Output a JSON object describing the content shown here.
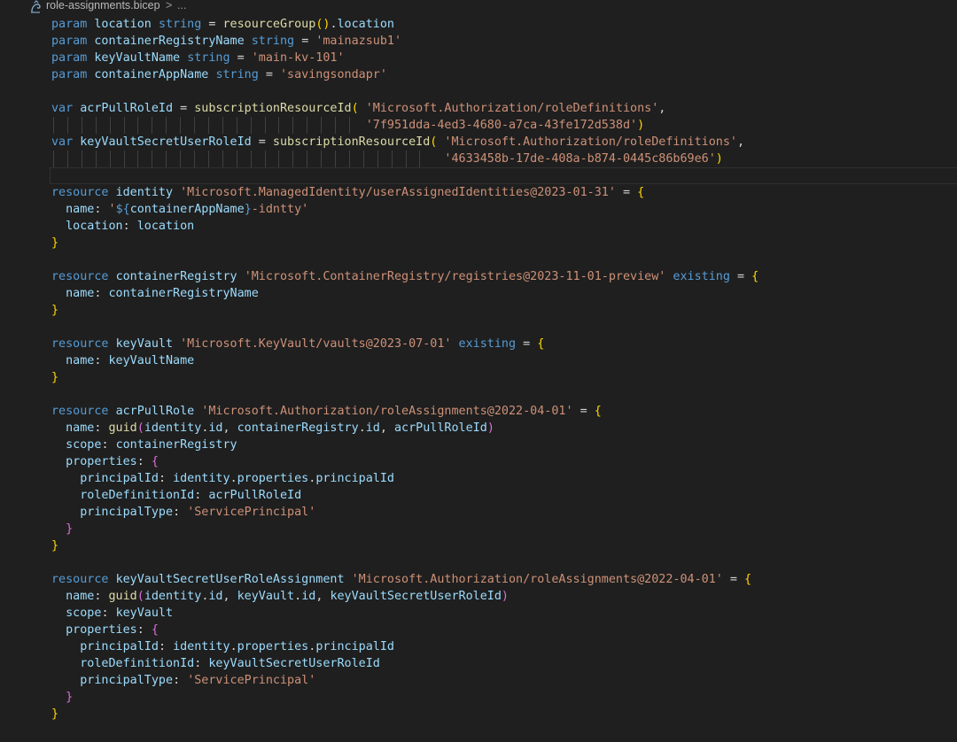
{
  "breadcrumb": {
    "file": "role-assignments.bicep",
    "separator": ">",
    "more": "..."
  },
  "code_lines": [
    "param location string = resourceGroup().location",
    "param containerRegistryName string = 'mainazsub1'",
    "param keyVaultName string = 'main-kv-101'",
    "param containerAppName string = 'savingsondapr'",
    "",
    "var acrPullRoleId = subscriptionResourceId( 'Microsoft.Authorization/roleDefinitions',",
    "                                            '7f951dda-4ed3-4680-a7ca-43fe172d538d')",
    "var keyVaultSecretUserRoleId = subscriptionResourceId( 'Microsoft.Authorization/roleDefinitions',",
    "                                                       '4633458b-17de-408a-b874-0445c86b69e6')",
    "",
    "resource identity 'Microsoft.ManagedIdentity/userAssignedIdentities@2023-01-31' = {",
    "  name: '${containerAppName}-idntty'",
    "  location: location",
    "}",
    "",
    "resource containerRegistry 'Microsoft.ContainerRegistry/registries@2023-11-01-preview' existing = {",
    "  name: containerRegistryName",
    "}",
    "",
    "resource keyVault 'Microsoft.KeyVault/vaults@2023-07-01' existing = {",
    "  name: keyVaultName",
    "}",
    "",
    "resource acrPullRole 'Microsoft.Authorization/roleAssignments@2022-04-01' = {",
    "  name: guid(identity.id, containerRegistry.id, acrPullRoleId)",
    "  scope: containerRegistry",
    "  properties: {",
    "    principalId: identity.properties.principalId",
    "    roleDefinitionId: acrPullRoleId",
    "    principalType: 'ServicePrincipal'",
    "  }",
    "}",
    "",
    "resource keyVaultSecretUserRoleAssignment 'Microsoft.Authorization/roleAssignments@2022-04-01' = {",
    "  name: guid(identity.id, keyVault.id, keyVaultSecretUserRoleId)",
    "  scope: keyVault",
    "  properties: {",
    "    principalId: identity.properties.principalId",
    "    roleDefinitionId: keyVaultSecretUserRoleId",
    "    principalType: 'ServicePrincipal'",
    "  }",
    "}"
  ],
  "colors": {
    "background": "#1f1f1f",
    "keyword": "#569cd6",
    "variable": "#9cdcfe",
    "function": "#dcdcaa",
    "string": "#ce9178",
    "bracket_level1": "#ffd700",
    "bracket_level2": "#da70d6",
    "bracket_level3": "#179fff"
  },
  "icons": {
    "file_icon": "bicep-file-icon"
  }
}
